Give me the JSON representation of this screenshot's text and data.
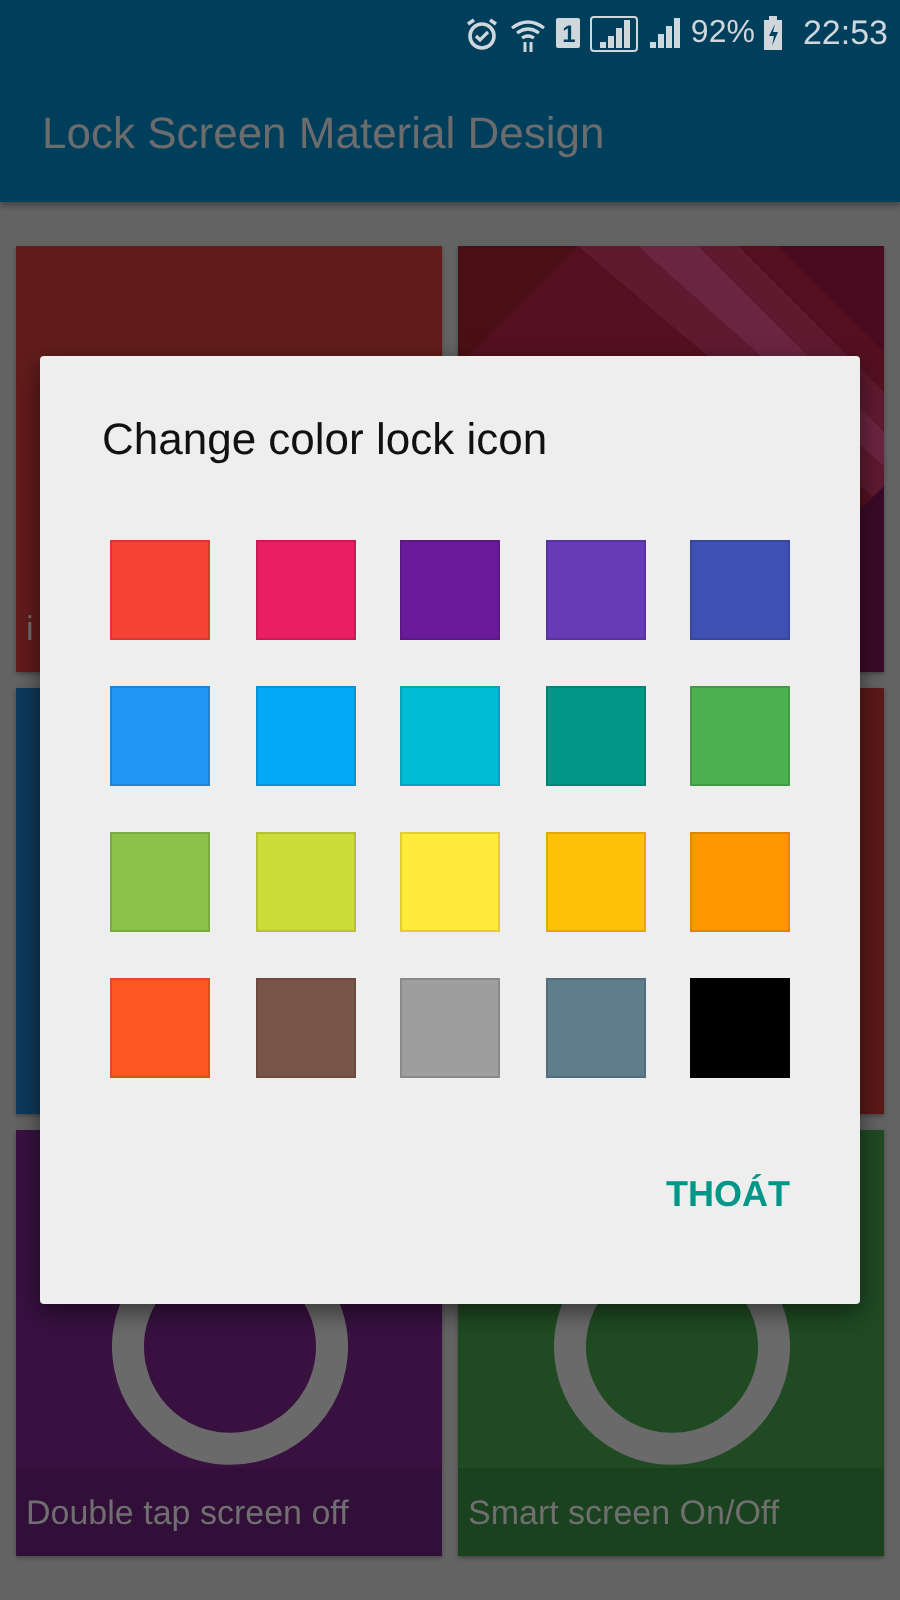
{
  "status_bar": {
    "sim": "1",
    "battery": "92%",
    "time": "22:53"
  },
  "app_bar": {
    "title": "Lock Screen Material Design"
  },
  "tiles": [
    {
      "kind": "plain",
      "label_lines": [
        "i"
      ]
    },
    {
      "kind": "pattern"
    },
    {
      "kind": "plain"
    },
    {
      "kind": "plain"
    },
    {
      "kind": "power",
      "label_lines": [
        "Double tap screen off"
      ]
    },
    {
      "kind": "power",
      "label_lines": [
        "Smart screen On/Off"
      ]
    }
  ],
  "dialog": {
    "title": "Change color lock icon",
    "swatches": [
      {
        "color": "#f44336"
      },
      {
        "color": "#e91e63"
      },
      {
        "color": "#6a1b9a"
      },
      {
        "color": "#673ab7"
      },
      {
        "color": "#3f51b5"
      },
      {
        "color": "#2196f3"
      },
      {
        "color": "#03a9f4"
      },
      {
        "color": "#00bcd4"
      },
      {
        "color": "#009688"
      },
      {
        "color": "#4caf50"
      },
      {
        "color": "#8bc34a"
      },
      {
        "color": "#cddc39"
      },
      {
        "color": "#ffeb3b"
      },
      {
        "color": "#ffc107"
      },
      {
        "color": "#ff9800"
      },
      {
        "color": "#ff5722"
      },
      {
        "color": "#795548"
      },
      {
        "color": "#9e9e9e"
      },
      {
        "color": "#607d8b"
      },
      {
        "color": "#000000"
      }
    ],
    "button": "THOÁT"
  }
}
